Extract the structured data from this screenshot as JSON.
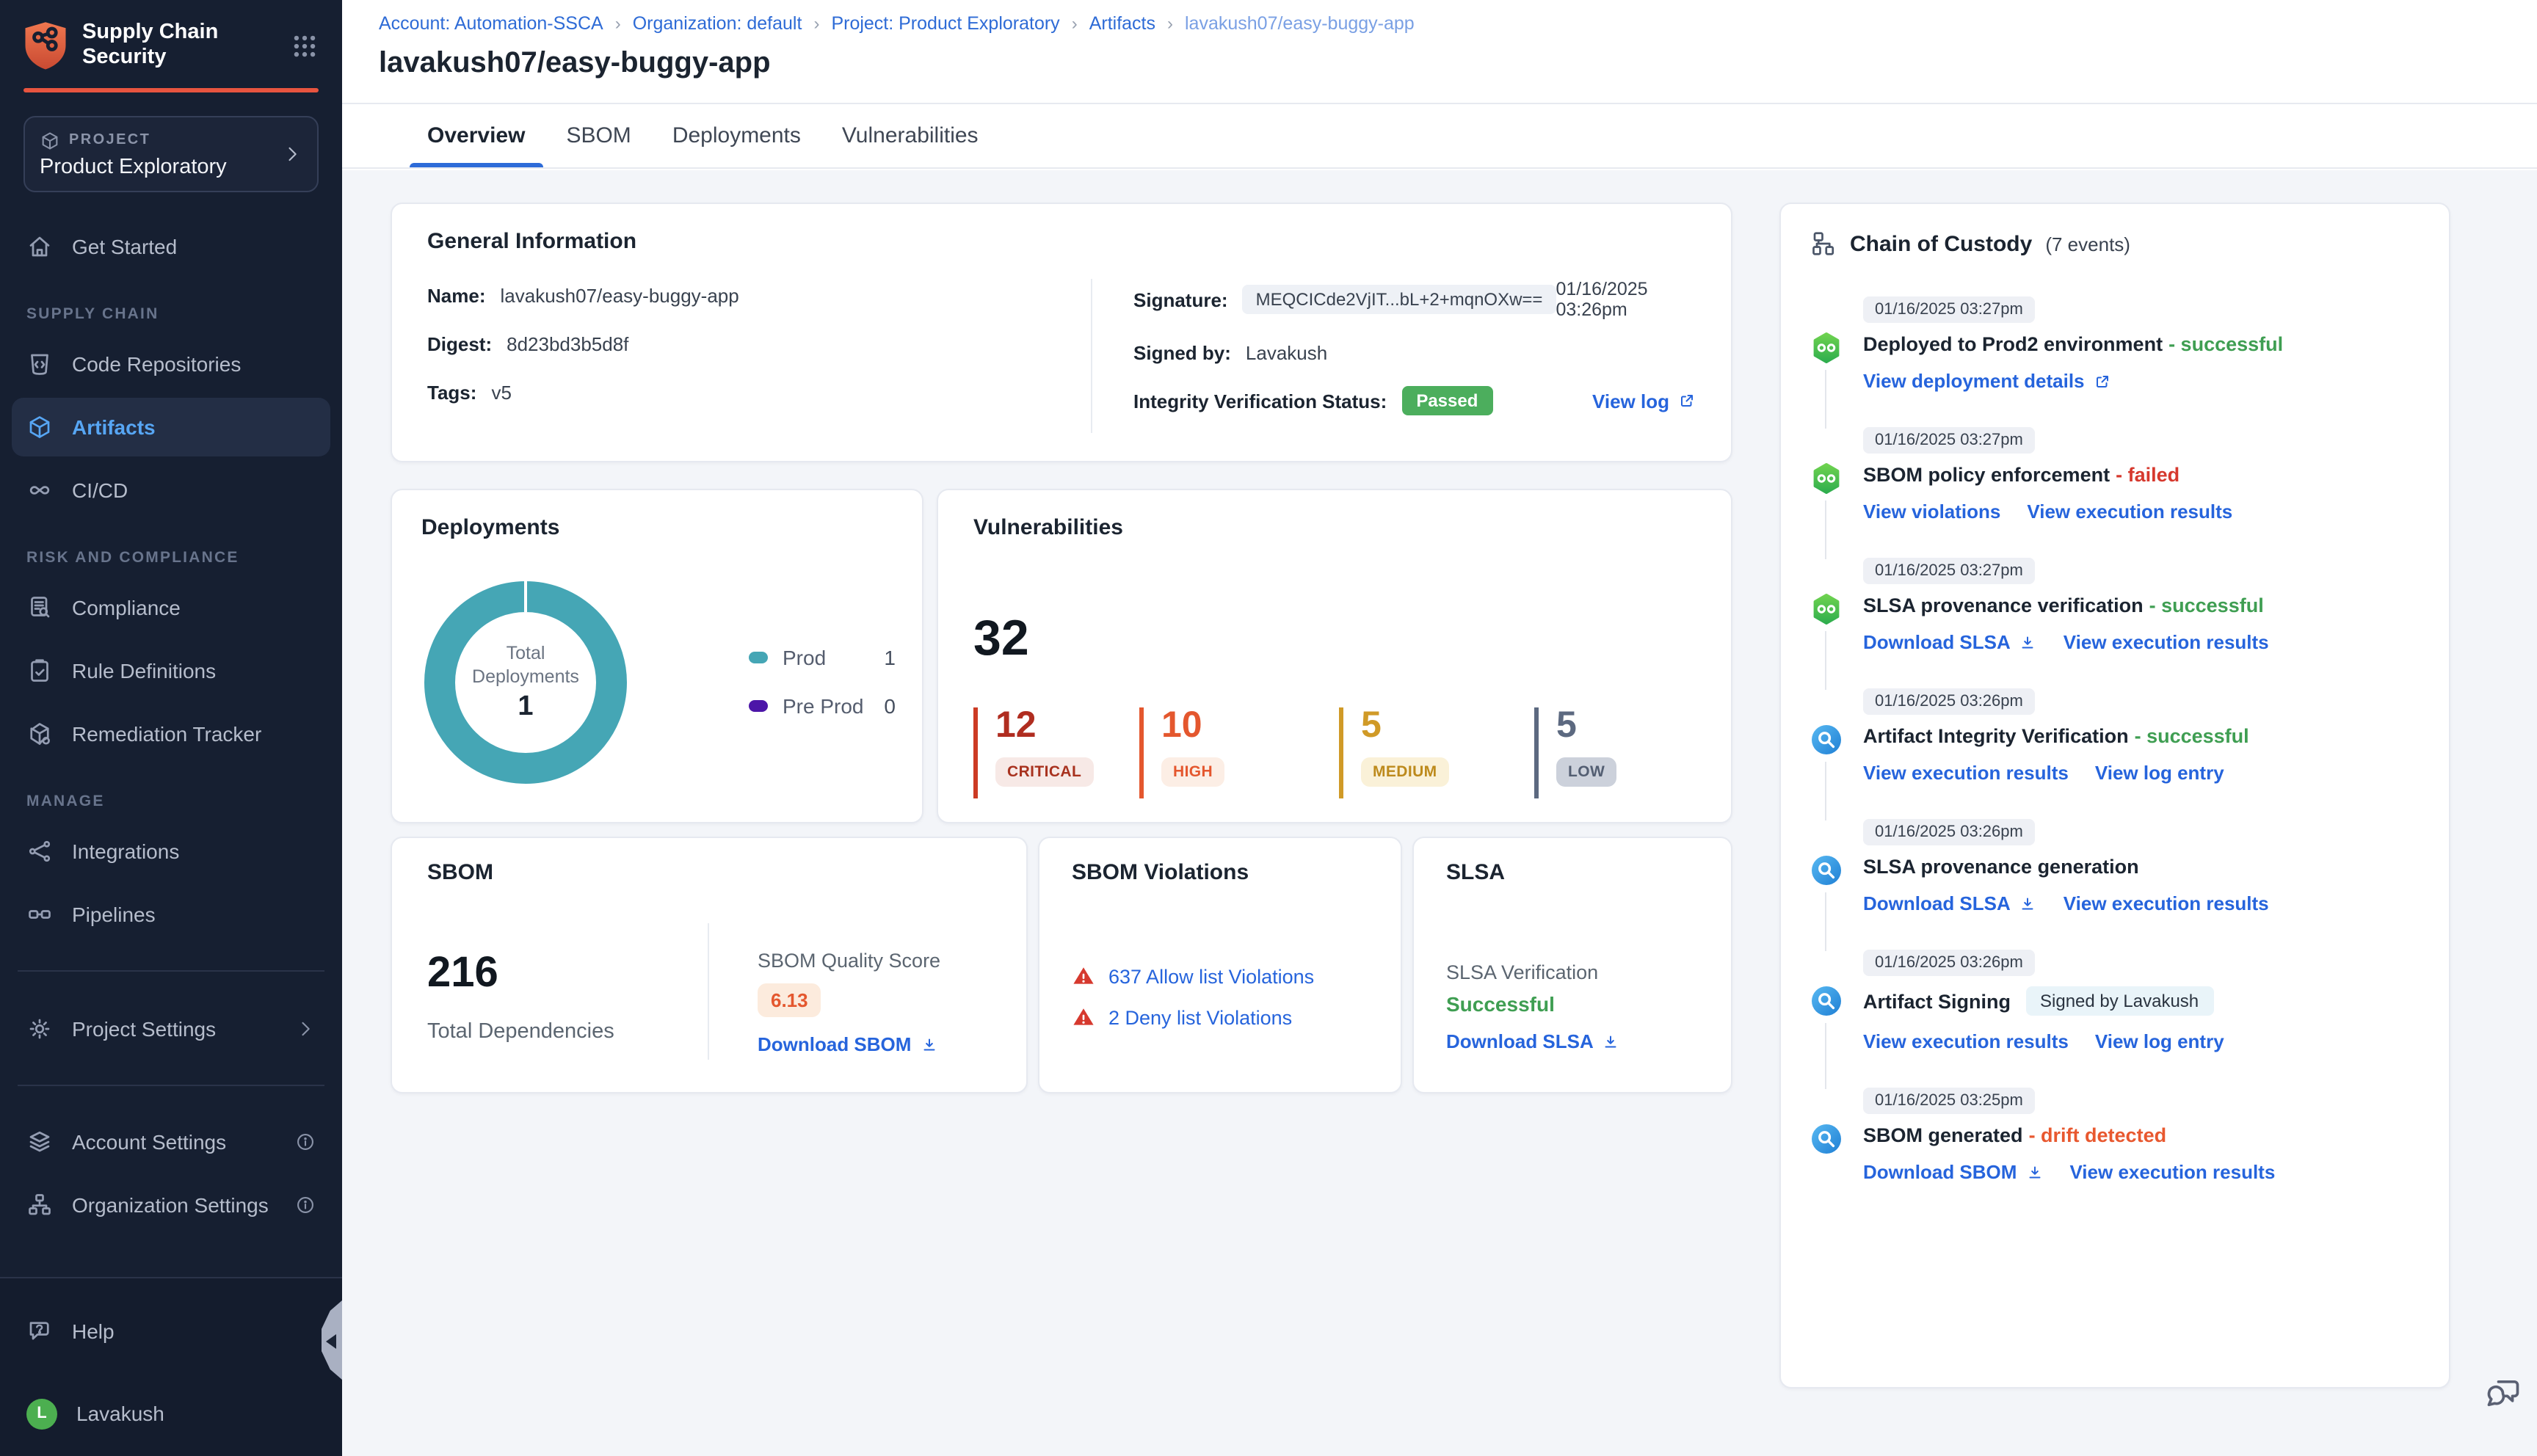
{
  "sidebar": {
    "logo_line1": "Supply Chain",
    "logo_line2": "Security",
    "project_label": "PROJECT",
    "project_name": "Product Exploratory",
    "nav": {
      "get_started": "Get Started",
      "supply_chain_label": "SUPPLY CHAIN",
      "code_repositories": "Code Repositories",
      "artifacts": "Artifacts",
      "cicd": "CI/CD",
      "risk_label": "RISK AND COMPLIANCE",
      "compliance": "Compliance",
      "rule_definitions": "Rule Definitions",
      "remediation_tracker": "Remediation Tracker",
      "manage_label": "MANAGE",
      "integrations": "Integrations",
      "pipelines": "Pipelines",
      "project_settings": "Project Settings",
      "account_settings": "Account Settings",
      "organization_settings": "Organization Settings",
      "help": "Help",
      "user": "Lavakush",
      "user_initial": "L"
    }
  },
  "breadcrumb": {
    "separator": "›",
    "items": [
      "Account: Automation-SSCA",
      "Organization: default",
      "Project: Product Exploratory",
      "Artifacts",
      "lavakush07/easy-buggy-app"
    ]
  },
  "page_title": "lavakush07/easy-buggy-app",
  "tabs": [
    "Overview",
    "SBOM",
    "Deployments",
    "Vulnerabilities"
  ],
  "general_info": {
    "title": "General Information",
    "name_label": "Name:",
    "name_value": "lavakush07/easy-buggy-app",
    "digest_label": "Digest:",
    "digest_value": "8d23bd3b5d8f",
    "tags_label": "Tags:",
    "tags_value": "v5",
    "signature_label": "Signature:",
    "signature_value": "MEQCICde2VjIT...bL+2+mqnOXw==",
    "signature_date": "01/16/2025 03:26pm",
    "signed_by_label": "Signed by:",
    "signed_by_value": "Lavakush",
    "integrity_label": "Integrity Verification Status:",
    "integrity_badge": "Passed",
    "view_log": "View log"
  },
  "deployments": {
    "title": "Deployments",
    "center_line1": "Total",
    "center_line2": "Deployments",
    "total": "1",
    "legend": [
      {
        "label": "Prod",
        "value": "1",
        "color": "#45a6b5"
      },
      {
        "label": "Pre Prod",
        "value": "0",
        "color": "#4c16a8"
      }
    ]
  },
  "vulnerabilities": {
    "title": "Vulnerabilities",
    "total": "32",
    "tiles": [
      {
        "count": "12",
        "label": "CRITICAL",
        "color": "#b02d20"
      },
      {
        "count": "10",
        "label": "HIGH",
        "color": "#e4572e"
      },
      {
        "count": "5",
        "label": "MEDIUM",
        "color": "#d09a27"
      },
      {
        "count": "5",
        "label": "LOW",
        "color": "#5c6980"
      }
    ]
  },
  "sbom": {
    "title": "SBOM",
    "total": "216",
    "total_label": "Total Dependencies",
    "quality_label": "SBOM Quality Score",
    "quality_score": "6.13",
    "download": "Download SBOM"
  },
  "sbom_violations": {
    "title": "SBOM Violations",
    "allow": "637 Allow list Violations",
    "deny": "2 Deny list Violations"
  },
  "slsa": {
    "title": "SLSA",
    "verification_label": "SLSA Verification",
    "verification_status": "Successful",
    "download": "Download SLSA"
  },
  "chain": {
    "title": "Chain of Custody",
    "count": "(7 events)",
    "events": [
      {
        "time": "01/16/2025 03:27pm",
        "title": "Deployed to Prod2 environment",
        "status": "- successful",
        "links": [
          {
            "label": "View deployment details"
          }
        ]
      },
      {
        "time": "01/16/2025 03:27pm",
        "title": "SBOM policy enforcement",
        "status": "- failed",
        "links": [
          {
            "label": "View violations"
          },
          {
            "label": "View execution results"
          }
        ]
      },
      {
        "time": "01/16/2025 03:27pm",
        "title": "SLSA provenance verification",
        "status": "- successful",
        "links": [
          {
            "label": "Download SLSA"
          },
          {
            "label": "View execution results"
          }
        ]
      },
      {
        "time": "01/16/2025 03:26pm",
        "title": "Artifact Integrity Verification",
        "status": "- successful",
        "links": [
          {
            "label": "View execution results"
          },
          {
            "label": "View log entry"
          }
        ]
      },
      {
        "time": "01/16/2025 03:26pm",
        "title": "SLSA provenance generation",
        "links": [
          {
            "label": "Download SLSA"
          },
          {
            "label": "View execution results"
          }
        ]
      },
      {
        "time": "01/16/2025 03:26pm",
        "title": "Artifact Signing",
        "badge": "Signed by Lavakush",
        "links": [
          {
            "label": "View execution results"
          },
          {
            "label": "View log entry"
          }
        ]
      },
      {
        "time": "01/16/2025 03:25pm",
        "title": "SBOM generated",
        "status": "- drift detected",
        "links": [
          {
            "label": "Download SBOM"
          },
          {
            "label": "View execution results"
          }
        ]
      }
    ]
  },
  "colors": {
    "sidebar_bg": "#161f31",
    "accent_red": "#e8543f",
    "active_blue": "#57a6f4",
    "link_blue": "#2664dc",
    "success_green": "#3f9e52",
    "fail_red": "#d6392e",
    "drift_orange": "#e8582f",
    "passed_badge": "#4cae5d",
    "donut_teal": "#45a6b5",
    "preprod_purple": "#4c16a8",
    "critical": "#b02d20",
    "high": "#e4572e",
    "medium": "#d09a27",
    "low": "#5c6980"
  }
}
